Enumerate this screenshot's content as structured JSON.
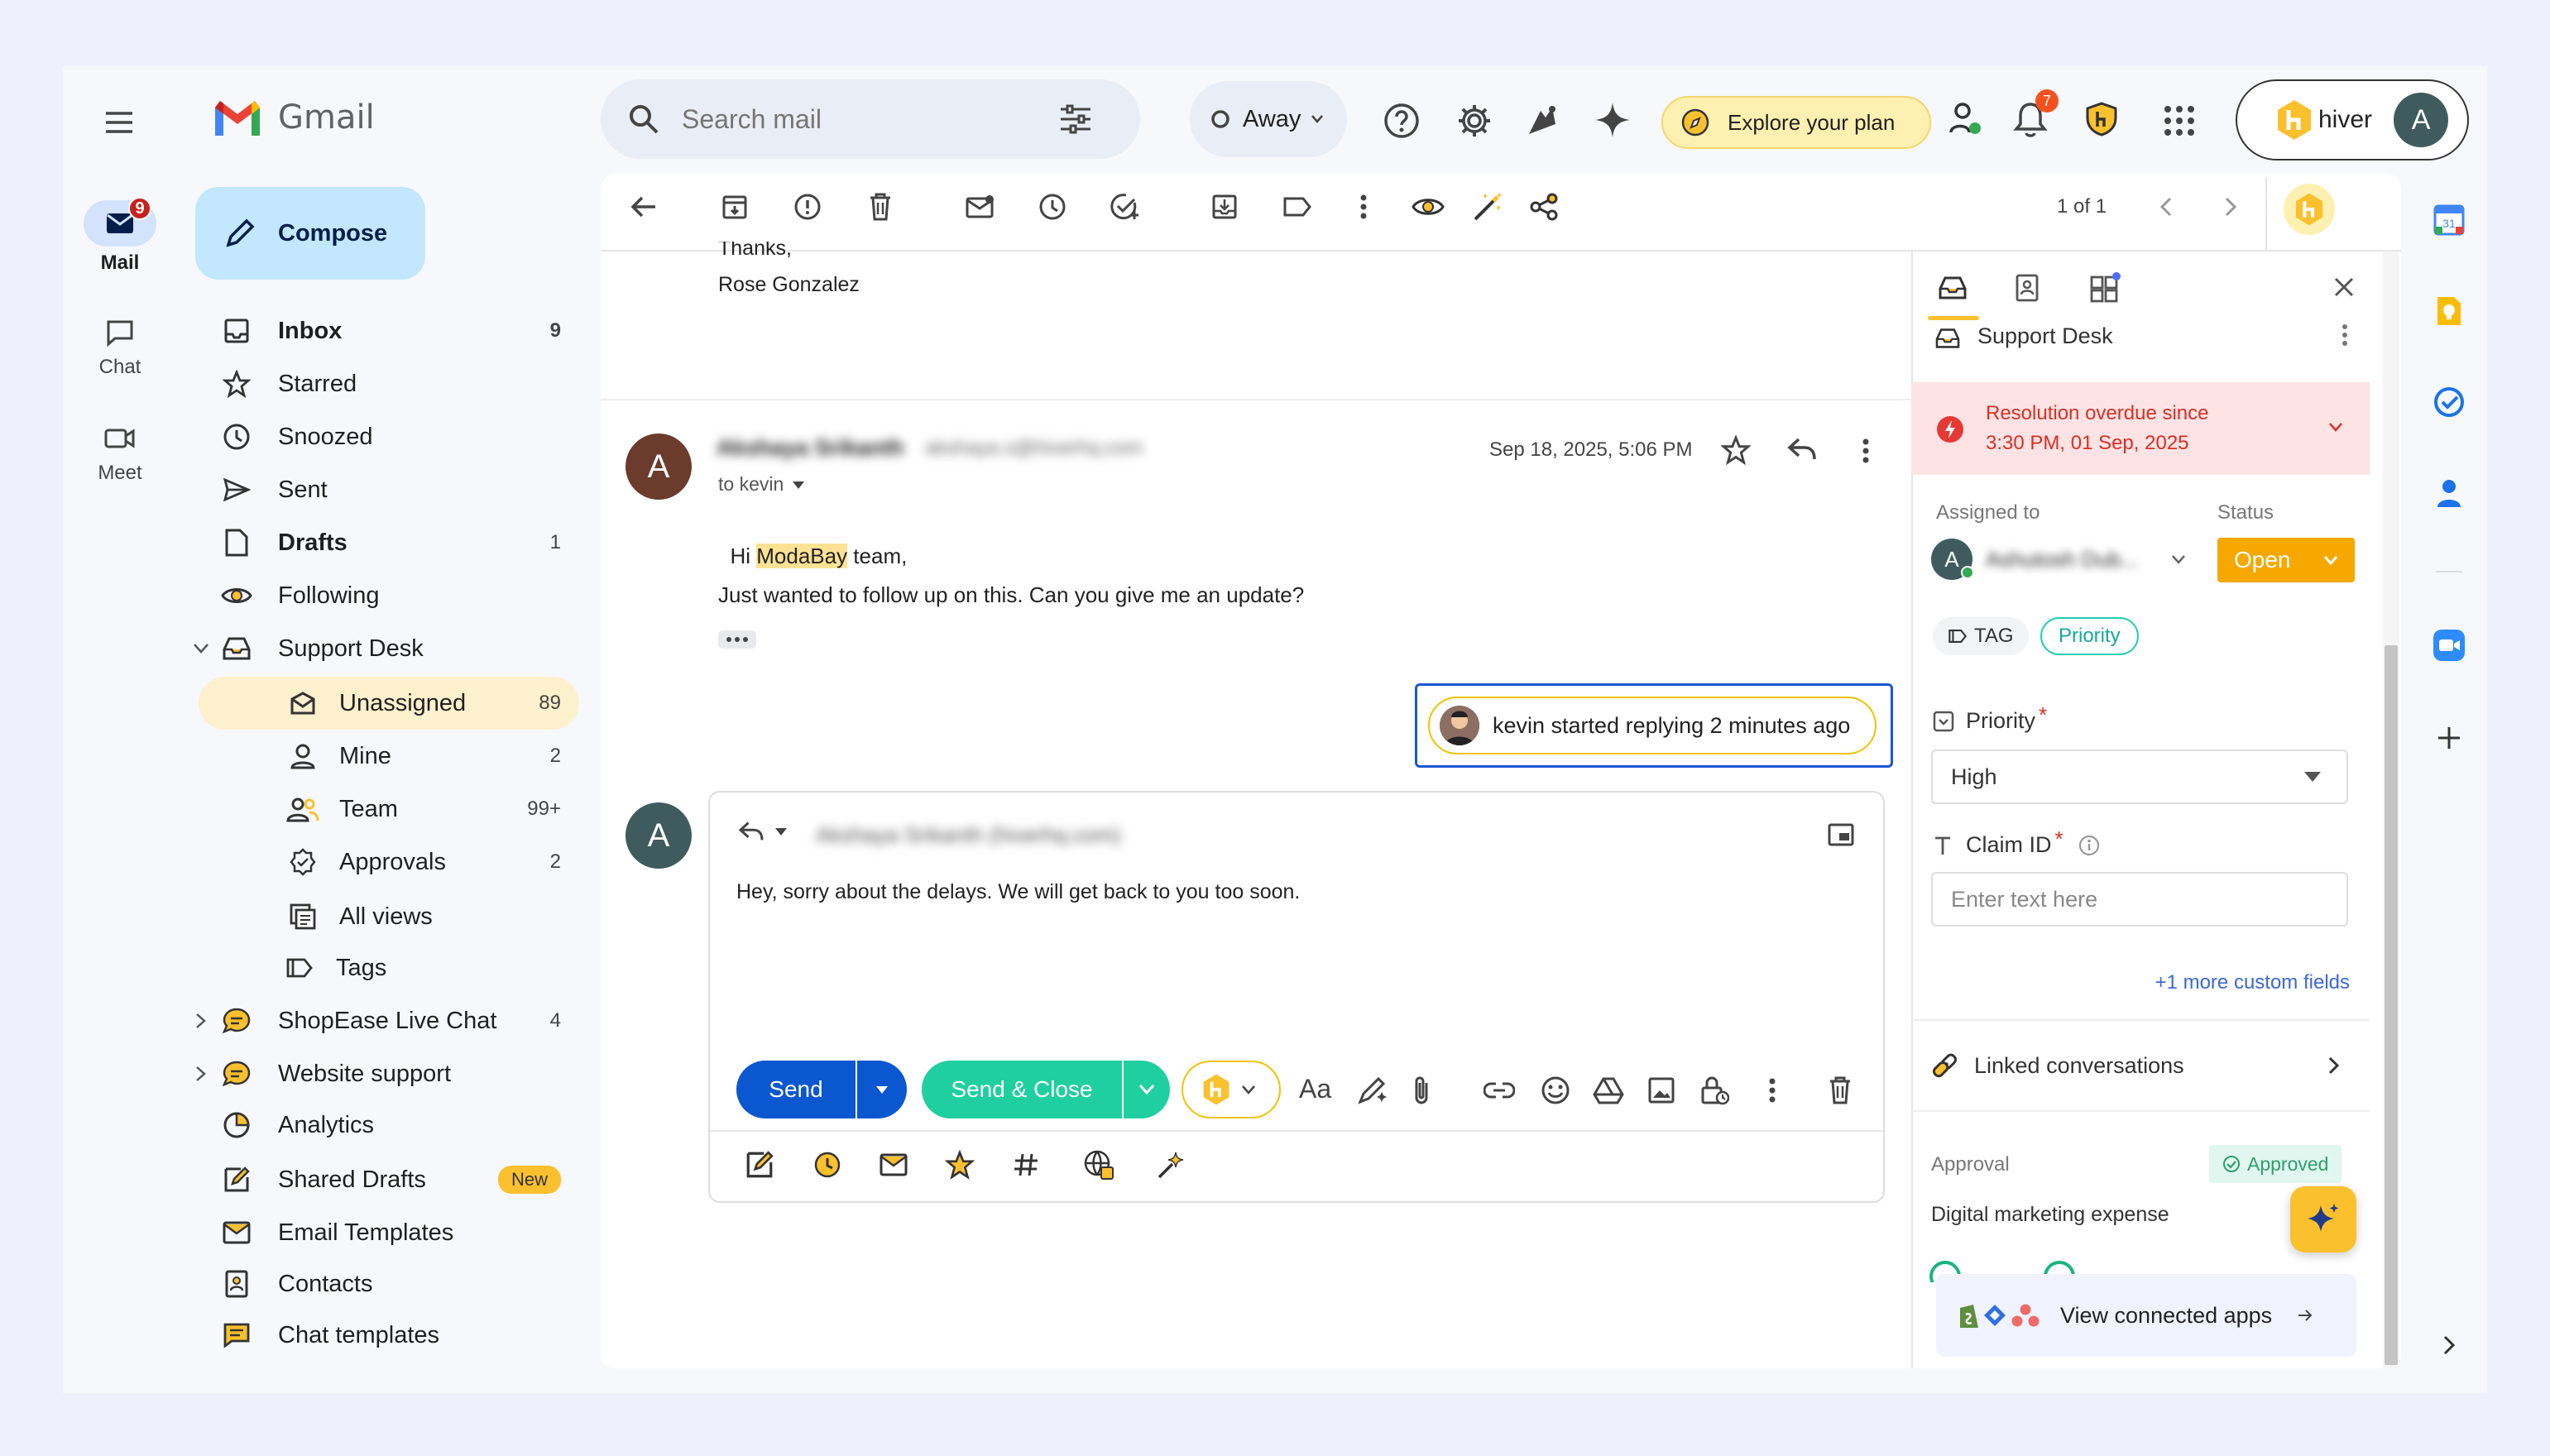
{
  "app": {
    "name": "Gmail"
  },
  "rail": {
    "mail_label": "Mail",
    "mail_badge": "9",
    "chat_label": "Chat",
    "meet_label": "Meet"
  },
  "compose_label": "Compose",
  "sidebar": {
    "inbox": {
      "label": "Inbox",
      "count": "9"
    },
    "starred": {
      "label": "Starred"
    },
    "snoozed": {
      "label": "Snoozed"
    },
    "sent": {
      "label": "Sent"
    },
    "drafts": {
      "label": "Drafts",
      "count": "1"
    },
    "following": {
      "label": "Following"
    },
    "support_desk": {
      "label": "Support Desk"
    },
    "unassigned": {
      "label": "Unassigned",
      "count": "89"
    },
    "mine": {
      "label": "Mine",
      "count": "2"
    },
    "team": {
      "label": "Team",
      "count": "99+"
    },
    "approvals": {
      "label": "Approvals",
      "count": "2"
    },
    "all_views": {
      "label": "All views"
    },
    "tags": {
      "label": "Tags"
    },
    "shopease": {
      "label": "ShopEase Live Chat",
      "count": "4"
    },
    "website_support": {
      "label": "Website support"
    },
    "analytics": {
      "label": "Analytics"
    },
    "shared_drafts": {
      "label": "Shared Drafts",
      "badge": "New"
    },
    "email_templates": {
      "label": "Email Templates"
    },
    "contacts": {
      "label": "Contacts"
    },
    "chat_templates": {
      "label": "Chat templates"
    }
  },
  "search": {
    "placeholder": "Search mail"
  },
  "status": {
    "label": "Away"
  },
  "explore_plan": {
    "label": "Explore your plan"
  },
  "notifications": {
    "count": "7"
  },
  "hiver": {
    "label": "hiver",
    "avatar": "A"
  },
  "toolbar": {
    "pagination": "1 of 1"
  },
  "thread": {
    "prev_tail": "Thanks,",
    "prev_signature": "Rose Gonzalez",
    "message": {
      "avatar": "A",
      "sender": "Akshaya Srikanth",
      "sender_email": "akshaya.s@hiverhq.com",
      "date": "Sep 18, 2025, 5:06 PM",
      "to": "to kevin",
      "greeting_pre": "Hi ",
      "greeting_highlight": "ModaBay",
      "greeting_post": " team,",
      "body": "Just wanted to follow up on this. Can you give me an update?"
    },
    "collision": "kevin started replying 2 minutes ago",
    "reply": {
      "avatar": "A",
      "to": "Akshaya Srikanth (hiverhq.com)",
      "body": "Hey, sorry about the delays. We will get back to you too soon.",
      "send_label": "Send",
      "send_close_label": "Send & Close",
      "font_label": "Aa"
    }
  },
  "panel": {
    "inbox_name": "Support Desk",
    "alert_line1": "Resolution overdue since",
    "alert_line2": "3:30 PM, 01 Sep, 2025",
    "assigned_label": "Assigned to",
    "assignee_avatar": "A",
    "assignee_name": "Ashutosh Dub...",
    "status_label": "Status",
    "status_value": "Open",
    "tag_label": "TAG",
    "priority_tag": "Priority",
    "priority_field_label": "Priority",
    "priority_value": "High",
    "claim_label": "Claim ID",
    "claim_placeholder": "Enter text here",
    "more_fields": "+1 more custom fields",
    "linked_label": "Linked conversations",
    "approval_label": "Approval",
    "approved_label": "Approved",
    "approval_item": "Digital marketing expense",
    "connected_apps": "View connected apps"
  },
  "colors": {
    "hiver_yellow": "#fbc02d",
    "send_blue": "#0b57d0",
    "send_close_green": "#1fcf9f",
    "alert_red": "#d93025",
    "compose_bg": "#c2e7ff",
    "selected_item": "#fdf0cc"
  }
}
